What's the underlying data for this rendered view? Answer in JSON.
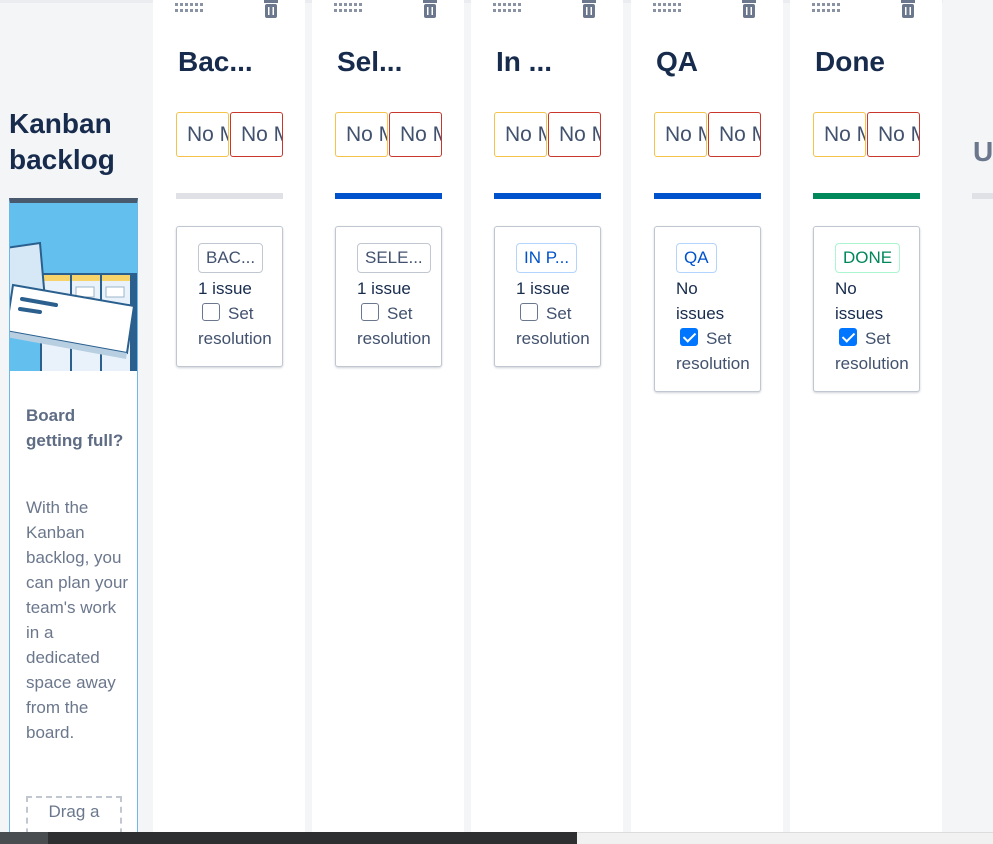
{
  "backlog": {
    "title": "Kanban backlog",
    "heading": "Board getting full?",
    "text": "With the Kanban backlog, you can plan your team's work in a dedicated space away from the board.",
    "drag_box": "Drag a"
  },
  "columns": [
    {
      "title": "Bac...",
      "min_limit": "No Min",
      "max_limit": "No Max",
      "bar_color": "#dfe1e6",
      "status": "BAC...",
      "status_style": "grey",
      "issue_count": "1 issue",
      "resolution_checked": false,
      "resolution_label": "Set resolution"
    },
    {
      "title": "Sel...",
      "min_limit": "No Min",
      "max_limit": "No Max",
      "bar_color": "#0052cc",
      "status": "SELE...",
      "status_style": "grey",
      "issue_count": "1 issue",
      "resolution_checked": false,
      "resolution_label": "Set resolution"
    },
    {
      "title": "In ...",
      "min_limit": "No Min",
      "max_limit": "No Max",
      "bar_color": "#0052cc",
      "status": "IN P...",
      "status_style": "blue",
      "issue_count": "1 issue",
      "resolution_checked": false,
      "resolution_label": "Set resolution"
    },
    {
      "title": "QA",
      "min_limit": "No Min",
      "max_limit": "No Max",
      "bar_color": "#0052cc",
      "status": "QA",
      "status_style": "blue",
      "issue_count": "No issues",
      "resolution_checked": true,
      "resolution_label": "Set resolution"
    },
    {
      "title": "Done",
      "min_limit": "No Min",
      "max_limit": "No Max",
      "bar_color": "#00875a",
      "status": "DONE",
      "status_style": "green",
      "issue_count": "No issues",
      "resolution_checked": true,
      "resolution_label": "Set resolution"
    }
  ],
  "partial_column": {
    "title": "U"
  },
  "icons": {
    "grip": "drag-handle-icon",
    "trash": "trash-icon"
  }
}
